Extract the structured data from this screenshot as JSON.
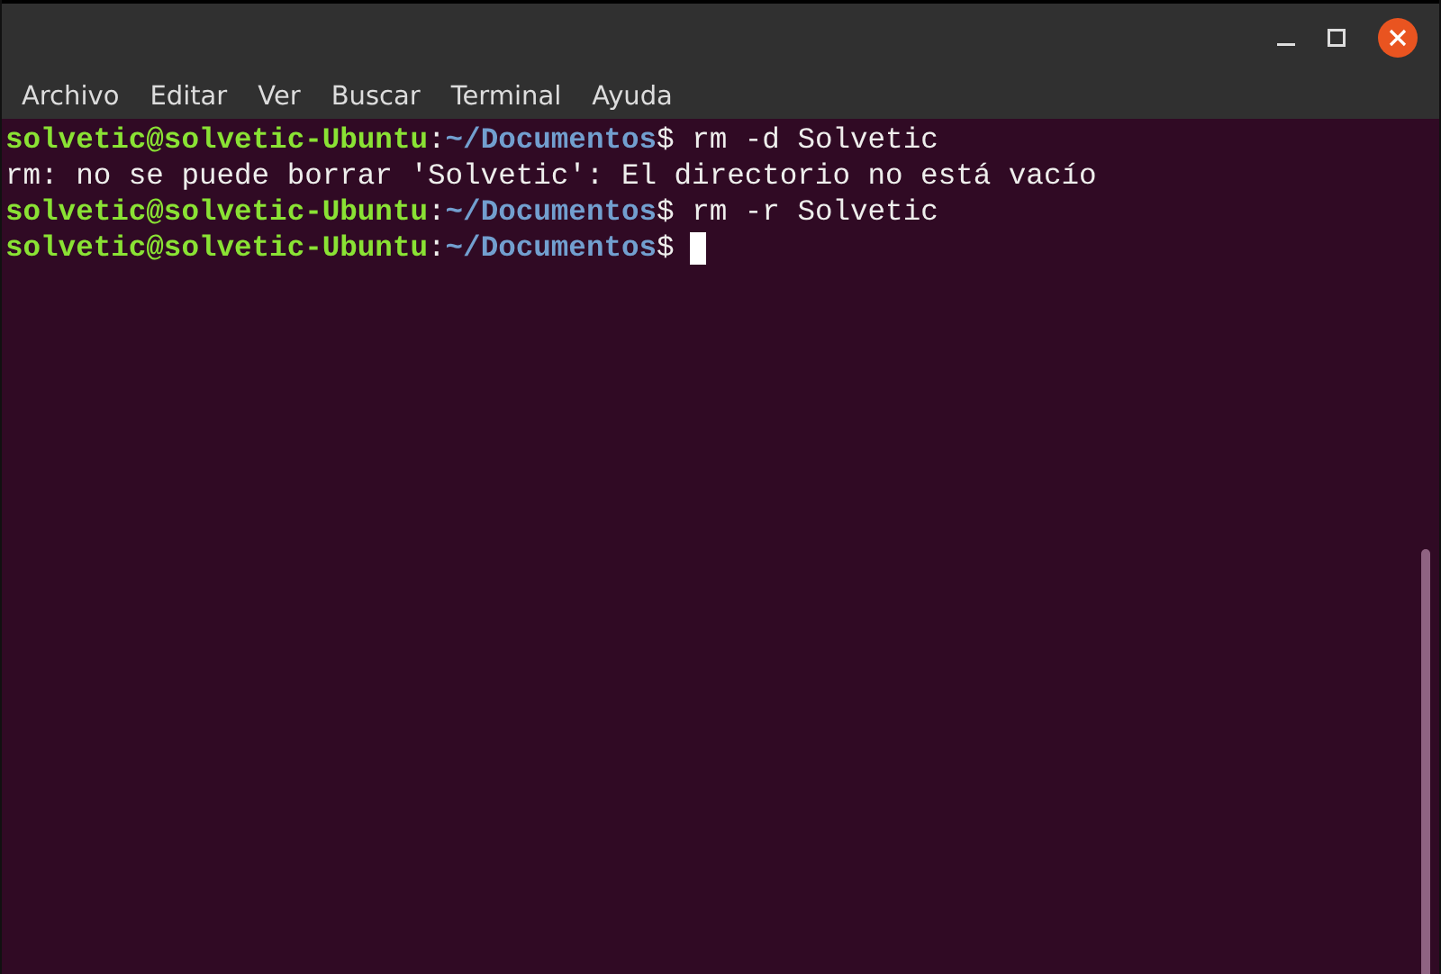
{
  "menu": [
    "Archivo",
    "Editar",
    "Ver",
    "Buscar",
    "Terminal",
    "Ayuda"
  ],
  "lines": [
    {
      "kind": "prompt",
      "user": "solvetic@solvetic-Ubuntu",
      "separator": ":",
      "path": "~/Documentos",
      "symbol": "$",
      "command": " rm -d Solvetic"
    },
    {
      "kind": "output",
      "text": "rm: no se puede borrar 'Solvetic': El directorio no está vacío"
    },
    {
      "kind": "prompt",
      "user": "solvetic@solvetic-Ubuntu",
      "separator": ":",
      "path": "~/Documentos",
      "symbol": "$",
      "command": " rm -r Solvetic"
    },
    {
      "kind": "prompt",
      "user": "solvetic@solvetic-Ubuntu",
      "separator": ":",
      "path": "~/Documentos",
      "symbol": "$",
      "cursor": true
    }
  ]
}
